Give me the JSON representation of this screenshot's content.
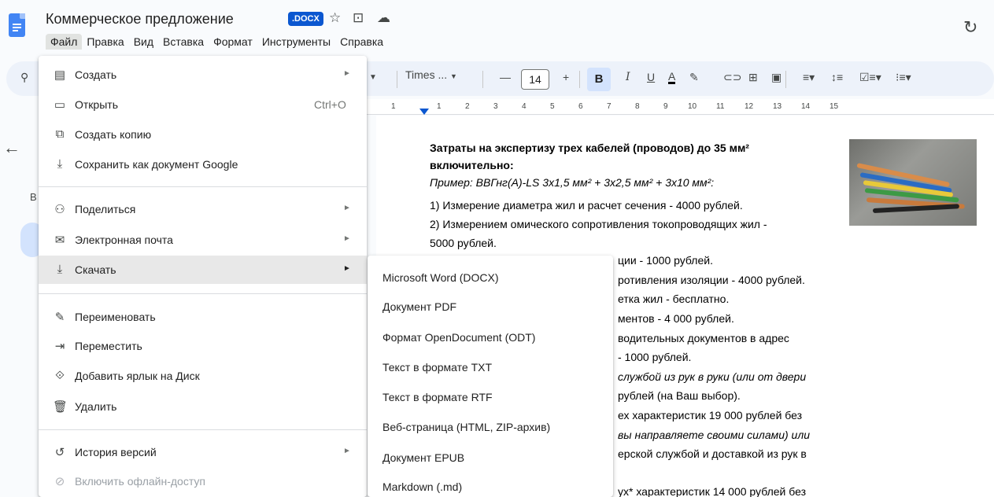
{
  "window": {
    "doc_title": "Коммерческое предложение",
    "doc_badge": ".DOCX",
    "star_icon": "☆",
    "move_icon": "⊡",
    "cloud_icon": "☁",
    "history_icon": "↻"
  },
  "menubar": [
    "Файл",
    "Правка",
    "Вид",
    "Вставка",
    "Формат",
    "Инструменты",
    "Справка"
  ],
  "toolbar": {
    "font": "Times ...",
    "font_size": "14",
    "bold": "B",
    "italic": "I",
    "underline": "U",
    "text_color": "A"
  },
  "ruler": [
    "1",
    "1",
    "2",
    "3",
    "4",
    "5",
    "6",
    "7",
    "8",
    "9",
    "10",
    "11",
    "12",
    "13",
    "14",
    "15"
  ],
  "left_panel": {
    "letter": "В"
  },
  "file_menu": [
    {
      "icon": "▤",
      "label": "Создать",
      "arrow": "►",
      "shortcut": ""
    },
    {
      "icon": "▭",
      "label": "Открыть",
      "arrow": "",
      "shortcut": "Ctrl+O"
    },
    {
      "icon": "⧉",
      "label": "Создать копию",
      "arrow": "",
      "shortcut": ""
    },
    {
      "icon": "⤓",
      "label": "Сохранить как документ Google",
      "arrow": "",
      "shortcut": ""
    },
    {
      "icon": "⚇",
      "label": "Поделиться",
      "arrow": "►",
      "shortcut": ""
    },
    {
      "icon": "✉",
      "label": "Электронная почта",
      "arrow": "►",
      "shortcut": ""
    },
    {
      "icon": "⤓",
      "label": "Скачать",
      "arrow": "►",
      "shortcut": ""
    },
    {
      "icon": "✎",
      "label": "Переименовать",
      "arrow": "",
      "shortcut": ""
    },
    {
      "icon": "⇥",
      "label": "Переместить",
      "arrow": "",
      "shortcut": ""
    },
    {
      "icon": "⟐",
      "label": "Добавить ярлык на Диск",
      "arrow": "",
      "shortcut": ""
    },
    {
      "icon": "🗑",
      "label": "Удалить",
      "arrow": "",
      "shortcut": ""
    },
    {
      "icon": "↺",
      "label": "История версий",
      "arrow": "►",
      "shortcut": ""
    },
    {
      "icon": "⊘",
      "label": "Включить офлайн-доступ",
      "arrow": "",
      "shortcut": ""
    }
  ],
  "download_submenu": [
    "Microsoft Word (DOCX)",
    "Документ PDF",
    "Формат OpenDocument (ODT)",
    "Текст в формате TXT",
    "Текст в формате RTF",
    "Веб-страница (HTML, ZIP-архив)",
    "Документ EPUB",
    "Markdown (.md)"
  ],
  "document": {
    "heading_1": "Затраты на экспертизу трех кабелей (проводов) до 35 мм²",
    "heading_2": "включительно:",
    "example": "Пример: ВВГнг(А)-LS 3х1,5 мм² + 3х2,5 мм² + 3х10 мм²:",
    "line_1": "1) Измерение диаметра жил и расчет сечения - 4000 рублей.",
    "line_2": "2) Измерением омического сопротивления токопроводящих жил -",
    "line_3": "5000 рублей.",
    "line_4": "ции - 1000 рублей.",
    "line_5": "ротивления изоляции - 4000 рублей.",
    "line_6": "етка жил - бесплатно.",
    "line_7": "ментов - 4 000 рублей.",
    "line_8": "водительных документов в адрес",
    "line_9": "- 1000 рублей.",
    "line_10": "службой из рук в руки (или от двери",
    "line_11": "рублей (на Ваш выбор).",
    "line_12": "ех характеристик 19 000 рублей без",
    "line_13": "вы направляете своими силами) или",
    "line_14": "ерской службой и доставкой из рук в",
    "line_15": "ух* характеристик 14 000 рублей без"
  }
}
